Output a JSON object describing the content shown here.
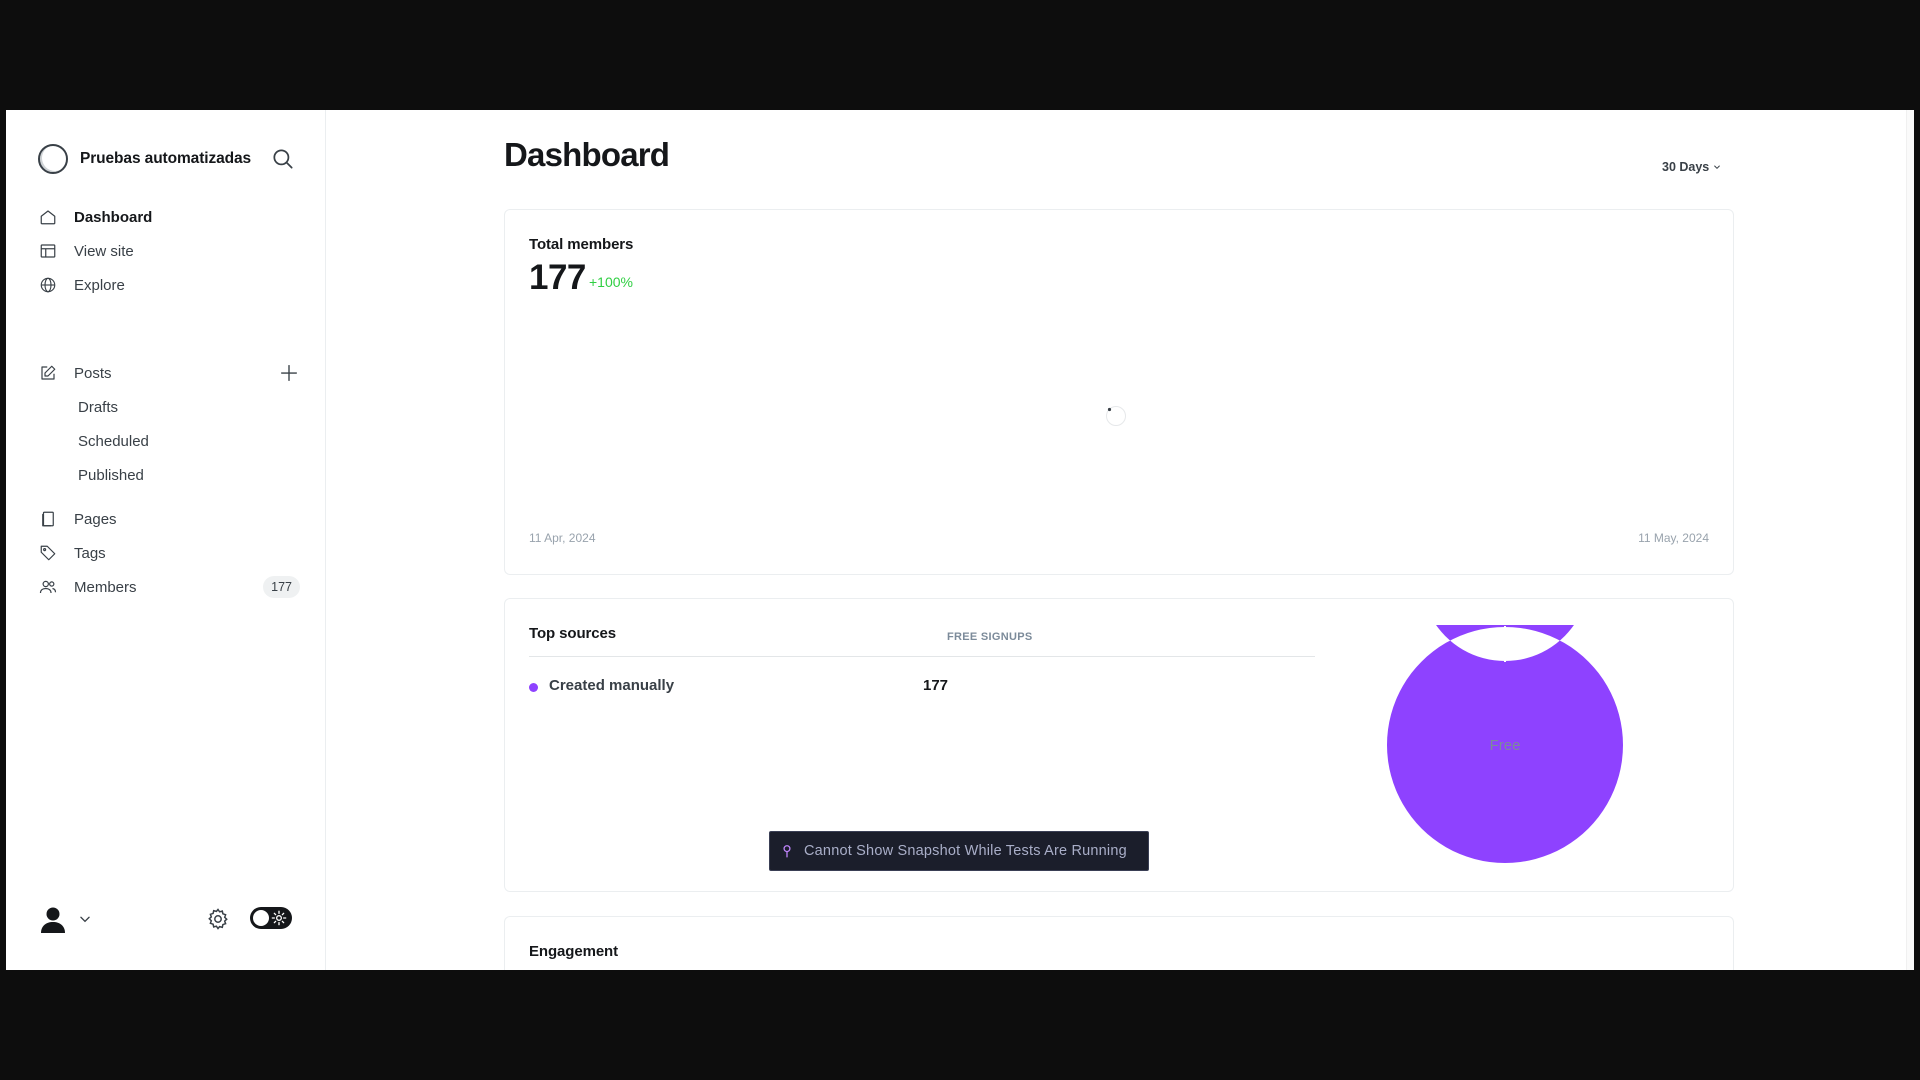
{
  "sidebar": {
    "site_name": "Pruebas automatizadas",
    "nav": [
      {
        "label": "Dashboard",
        "icon": "home-icon"
      },
      {
        "label": "View site",
        "icon": "layout-icon"
      },
      {
        "label": "Explore",
        "icon": "globe-icon"
      }
    ],
    "posts": {
      "label": "Posts",
      "sub": [
        "Drafts",
        "Scheduled",
        "Published"
      ]
    },
    "other": [
      {
        "label": "Pages",
        "icon": "pages-icon"
      },
      {
        "label": "Tags",
        "icon": "tag-icon"
      },
      {
        "label": "Members",
        "icon": "members-icon",
        "count": "177"
      }
    ]
  },
  "header": {
    "title": "Dashboard",
    "range": "30 Days"
  },
  "members_card": {
    "title": "Total members",
    "value": "177",
    "change": "+100%",
    "date_start": "11 Apr, 2024",
    "date_end": "11 May, 2024"
  },
  "sources_card": {
    "title": "Top sources",
    "column": "FREE SIGNUPS",
    "rows": [
      {
        "name": "Created manually",
        "value": "177"
      }
    ],
    "donut_label": "Free"
  },
  "engagement_card": {
    "title": "Engagement"
  },
  "toast": {
    "text": "Cannot Show Snapshot While Tests Are Running"
  },
  "chart_data": {
    "type": "pie",
    "categories": [
      "Free"
    ],
    "values": [
      177
    ],
    "title": "",
    "colors": [
      "#8e42ff"
    ]
  },
  "colors": {
    "accent": "#8e42ff",
    "positive": "#30cf43",
    "text": "#15171a"
  }
}
